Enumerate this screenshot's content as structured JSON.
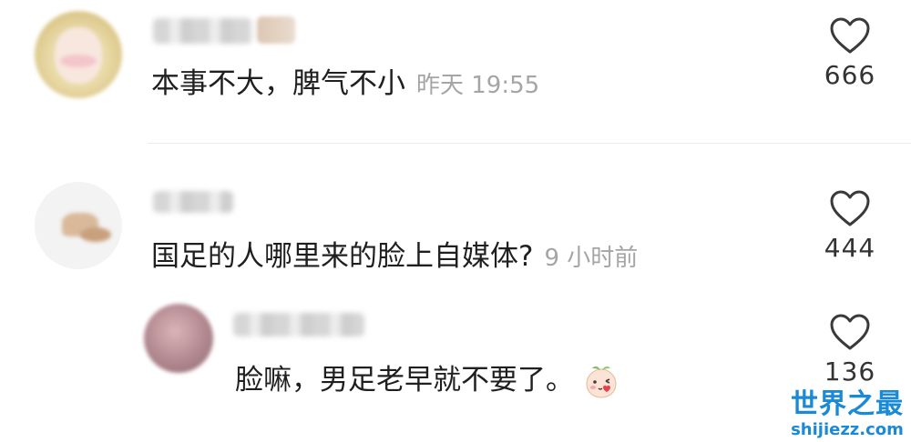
{
  "comments": [
    {
      "author_blurred": true,
      "text": "本事不大，脾气不小",
      "time": "昨天 19:55",
      "likes": "666"
    },
    {
      "author_blurred": true,
      "text": "国足的人哪里来的脸上自媒体?",
      "time": "9 小时前",
      "likes": "444"
    },
    {
      "author_blurred": true,
      "is_reply": true,
      "text": "脸嘛，男足老早就不要了。",
      "emoji": "peach-face-emoji",
      "likes": "136"
    }
  ],
  "icons": {
    "like": "heart-outline-icon"
  },
  "watermark": {
    "title": "世界之最",
    "url": "shijiezz.com"
  },
  "colors": {
    "text": "#1f1f1f",
    "meta": "#a5a5a5",
    "watermark": "#1a8ad6"
  }
}
